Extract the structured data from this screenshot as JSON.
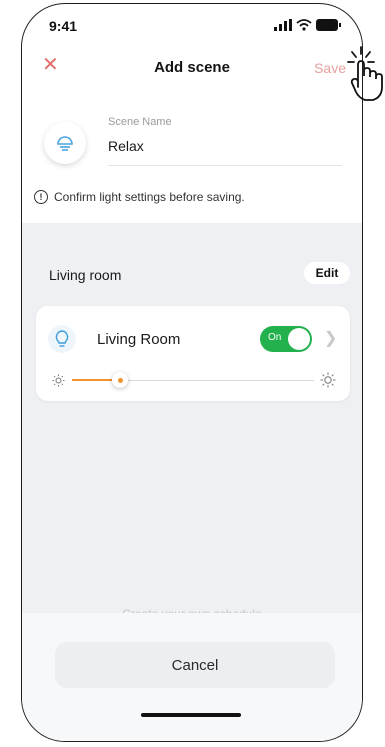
{
  "status_bar": {
    "time": "9:41"
  },
  "header": {
    "title": "Add scene",
    "save_label": "Save"
  },
  "scene": {
    "name_label": "Scene Name",
    "name_value": "Relax"
  },
  "notice": {
    "text": "Confirm light settings before saving."
  },
  "room": {
    "label": "Living room",
    "edit_label": "Edit"
  },
  "light": {
    "name": "Living Room",
    "toggle_label": "On",
    "is_on": true,
    "brightness_fraction": 0.2
  },
  "sheet": {
    "partial_text": "Create your own schedule",
    "cancel_label": "Cancel"
  },
  "colors": {
    "accent_red": "#e36d6d",
    "toggle_green": "#23b14d",
    "slider_orange": "#f2932c"
  },
  "icons": {
    "close": "close-icon",
    "scene": "lightbulb-icon",
    "info": "info-icon",
    "chevron": "chevron-right-icon",
    "hand": "tap-hand-icon",
    "sun_low": "brightness-low-icon",
    "sun_high": "brightness-high-icon"
  }
}
